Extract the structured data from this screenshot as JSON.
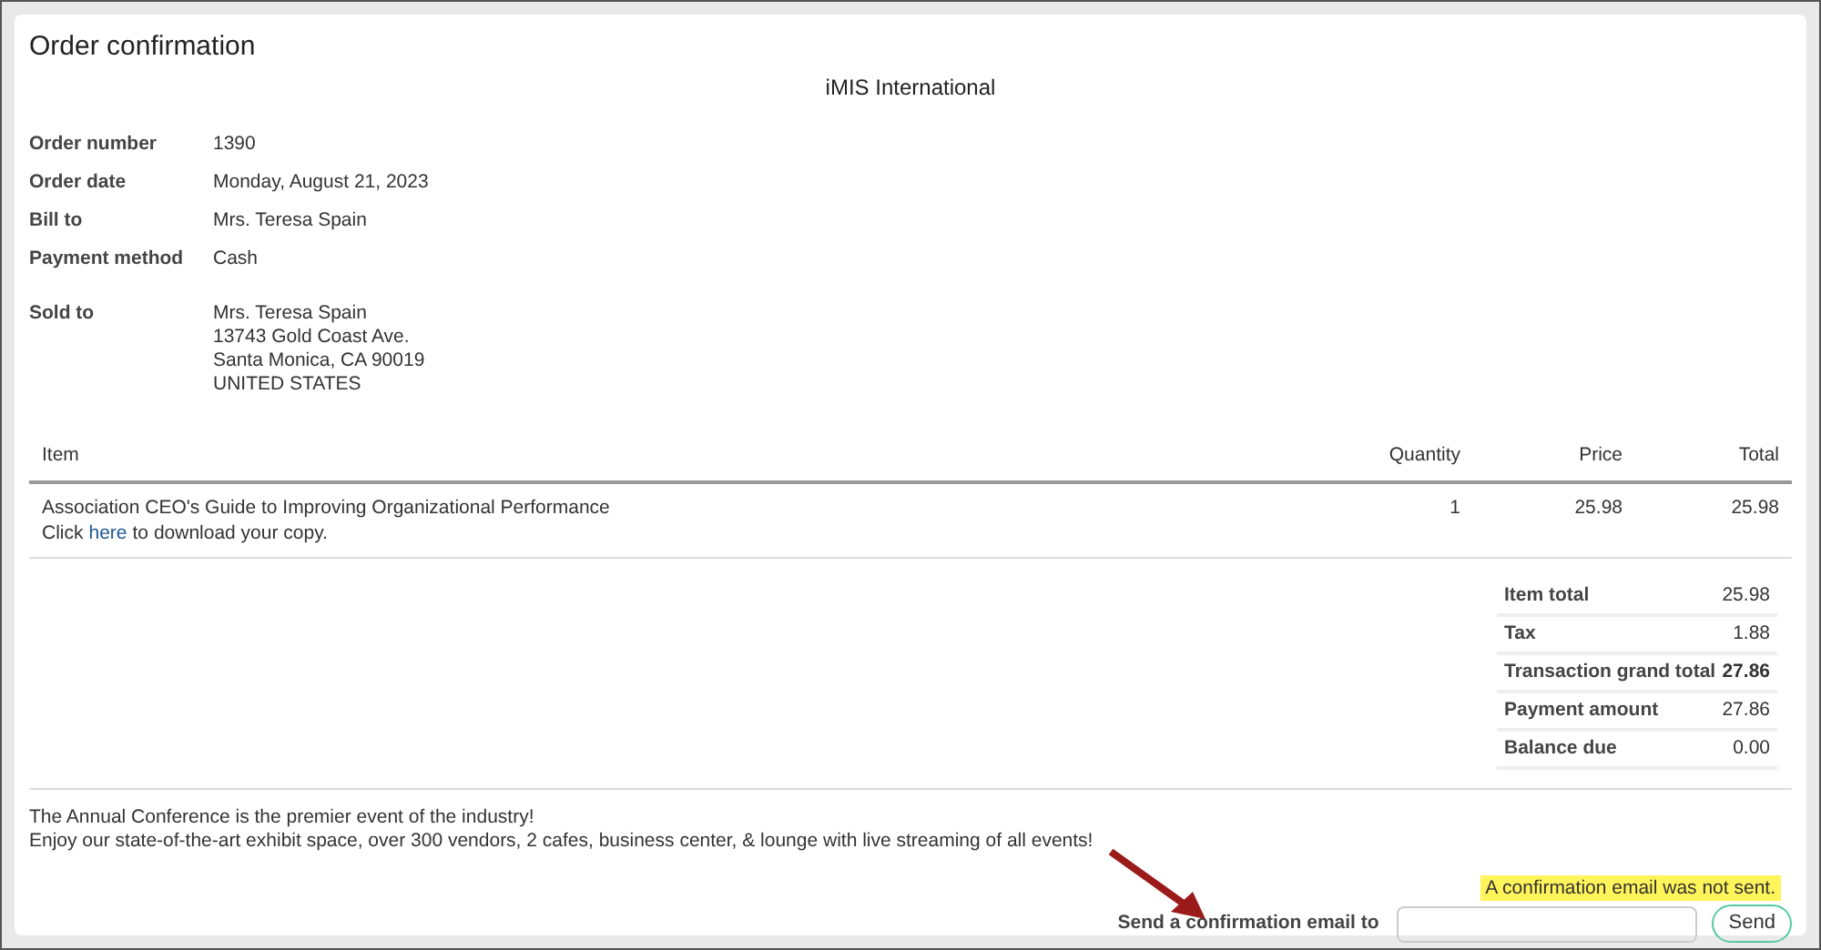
{
  "title": "Order confirmation",
  "organization": "iMIS International",
  "details": [
    {
      "label": "Order number",
      "value": [
        "1390"
      ]
    },
    {
      "label": "Order date",
      "value": [
        "Monday, August 21, 2023"
      ]
    },
    {
      "label": "Bill to",
      "value": [
        "Mrs. Teresa Spain"
      ]
    },
    {
      "label": "Payment method",
      "value": [
        "Cash"
      ]
    },
    {
      "label": "Sold to",
      "value": [
        "Mrs. Teresa Spain",
        "13743 Gold Coast Ave.",
        "Santa Monica, CA 90019",
        "UNITED STATES"
      ]
    }
  ],
  "table": {
    "columns": [
      "Item",
      "Quantity",
      "Price",
      "Total"
    ],
    "rows": [
      {
        "item": "Association CEO's Guide to Improving Organizational Performance",
        "note": {
          "before": "Click",
          "link": "here",
          "after": "to download your copy."
        },
        "quantity": "1",
        "price": "25.98",
        "total": "25.98"
      }
    ]
  },
  "totals": [
    {
      "label": "Item total",
      "value": "25.98",
      "bold": false
    },
    {
      "label": "Tax",
      "value": "1.88",
      "bold": false
    },
    {
      "label": "Transaction grand total",
      "value": "27.86",
      "bold": true
    },
    {
      "label": "Payment amount",
      "value": "27.86",
      "bold": false
    },
    {
      "label": "Balance due",
      "value": "0.00",
      "bold": false
    }
  ],
  "message": [
    "The Annual Conference is the premier event of the industry!",
    "Enjoy our state-of-the-art exhibit space, over 300 vendors, 2 cafes, business center, & lounge with live streaming of all events!"
  ],
  "email": {
    "notice": "A confirmation email was not sent.",
    "label": "Send a confirmation email to",
    "button": "Send"
  }
}
